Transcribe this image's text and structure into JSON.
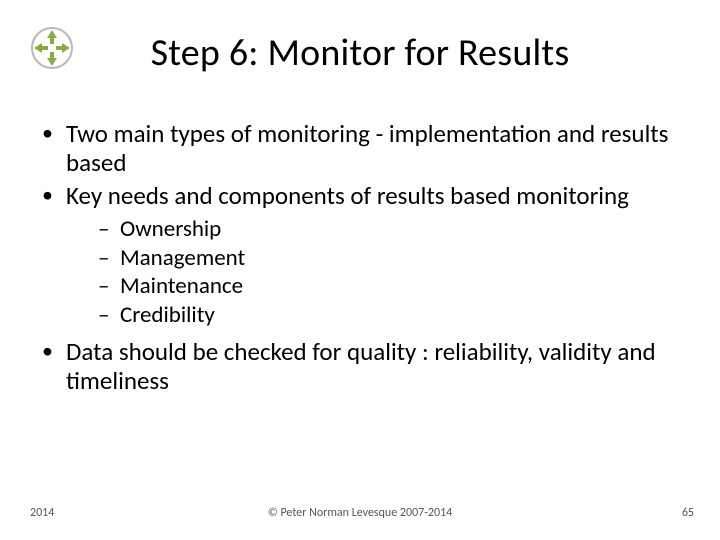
{
  "title": "Step 6: Monitor for Results",
  "bullets": {
    "b1": "Two main types of monitoring  - implementation and results based",
    "b2": "Key needs and components of results based monitoring",
    "sub": {
      "s1": "Ownership",
      "s2": "Management",
      "s3": "Maintenance",
      "s4": "Credibility"
    },
    "b3": "Data should be checked for quality : reliability, validity and timeliness"
  },
  "footer": {
    "year": "2014",
    "copyright": "© Peter Norman Levesque 2007-2014",
    "page": "65"
  },
  "icon_name": "arrows-circle-logo"
}
